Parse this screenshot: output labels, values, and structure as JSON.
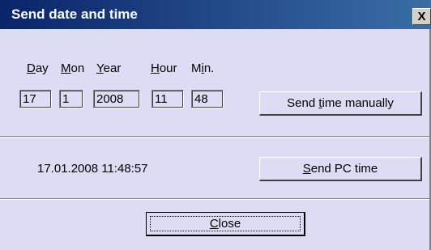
{
  "window": {
    "title": "Send date and time",
    "close_glyph": "X"
  },
  "labels": {
    "day_letter": "D",
    "day_rest": "ay",
    "mon_letter": "M",
    "mon_rest": "on",
    "year_letter": "Y",
    "year_rest": "ear",
    "hour_letter": "H",
    "hour_rest": "our",
    "min_pre": "M",
    "min_letter": "i",
    "min_rest": "n."
  },
  "fields": {
    "day": "17",
    "month": "1",
    "year": "2008",
    "hour": "11",
    "minute": "48"
  },
  "buttons": {
    "send_manual_pre": "Send ",
    "send_manual_letter": "t",
    "send_manual_rest": "ime manually",
    "send_pc_letter": "S",
    "send_pc_rest": "end PC time",
    "close_letter": "C",
    "close_rest": "lose"
  },
  "pc_time": "17.01.2008 11:48:57",
  "colors": {
    "titlebar_start": "#0a246a",
    "titlebar_end": "#3a6ea5",
    "dialog_bg": "#dcdcf4"
  },
  "icons": {
    "close": "close-icon"
  }
}
